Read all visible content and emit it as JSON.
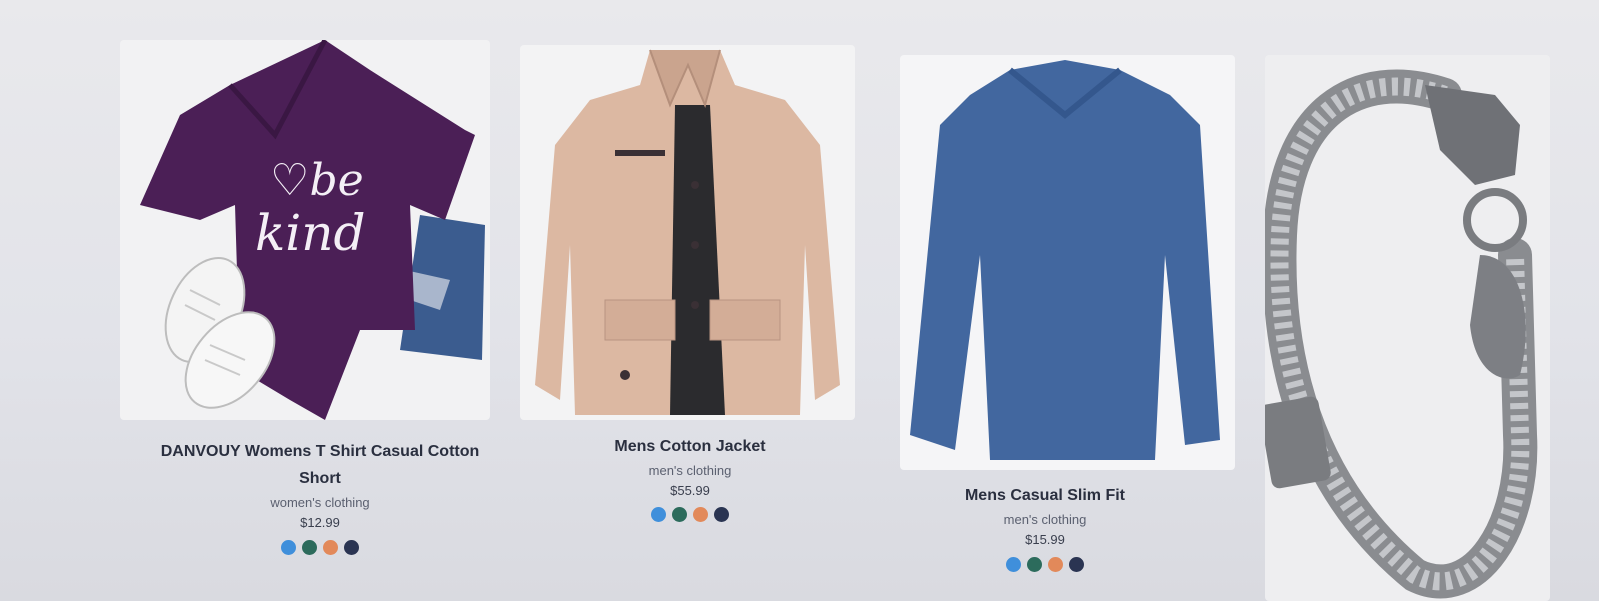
{
  "products": [
    {
      "title": "DANVOUY Womens T Shirt Casual Cotton Short",
      "category": "women's clothing",
      "price": "$12.99",
      "print": "be kind",
      "image_icon": "tshirt-image"
    },
    {
      "title": "Mens Cotton Jacket",
      "category": "men's clothing",
      "price": "$55.99",
      "image_icon": "jacket-image"
    },
    {
      "title": "Mens Casual Slim Fit",
      "category": "men's clothing",
      "price": "$15.99",
      "image_icon": "longsleeve-shirt-image"
    },
    {
      "title": "",
      "category": "",
      "price": "",
      "image_icon": "bracelet-image"
    }
  ],
  "swatch_colors": [
    "#3f8fdb",
    "#2c6b5c",
    "#e2895a",
    "#2a3452"
  ]
}
